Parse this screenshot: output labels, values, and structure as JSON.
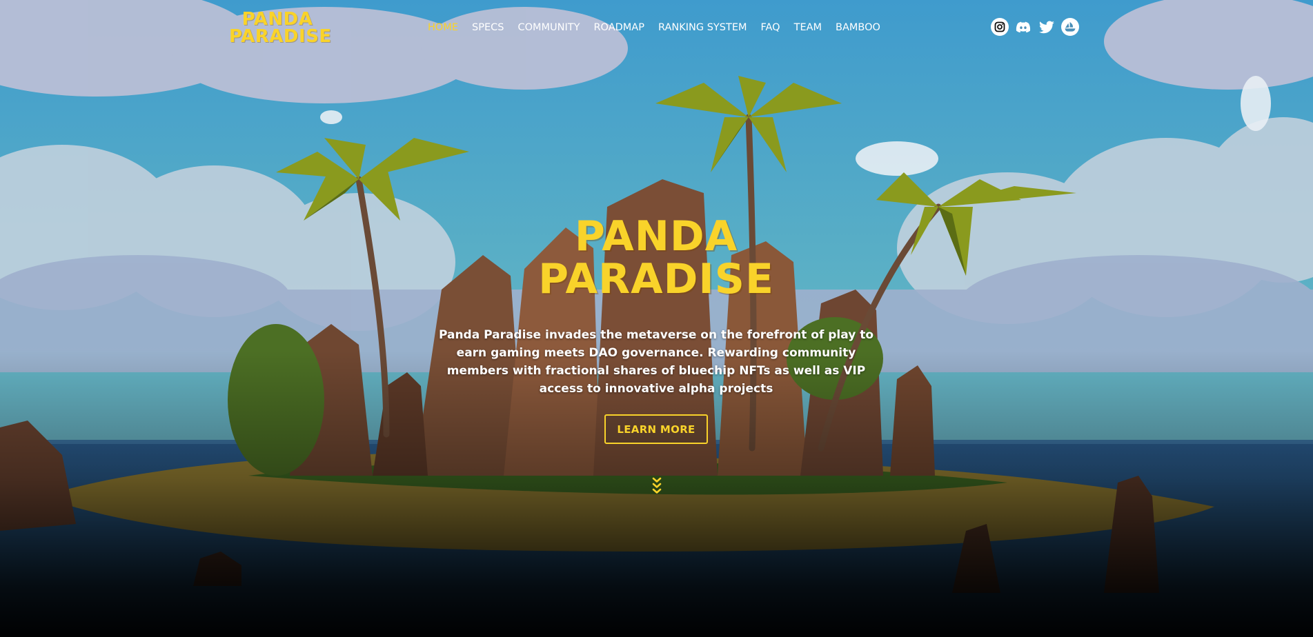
{
  "header": {
    "logo_line1": "PANDA",
    "logo_line2": "PARADISE"
  },
  "nav": {
    "items": [
      {
        "label": "HOME",
        "active": true
      },
      {
        "label": "SPECS",
        "active": false
      },
      {
        "label": "COMMUNITY",
        "active": false
      },
      {
        "label": "ROADMAP",
        "active": false
      },
      {
        "label": "RANKING SYSTEM",
        "active": false
      },
      {
        "label": "FAQ",
        "active": false
      },
      {
        "label": "TEAM",
        "active": false
      },
      {
        "label": "BAMBOO",
        "active": false
      }
    ]
  },
  "social": {
    "icons": [
      "instagram-icon",
      "discord-icon",
      "twitter-icon",
      "opensea-icon"
    ]
  },
  "hero": {
    "title_line1": "PANDA",
    "title_line2": "PARADISE",
    "description": "Panda Paradise invades the metaverse on the forefront of play to earn gaming meets DAO governance. Rewarding community members with fractional shares of bluechip NFTs as well as VIP access to innovative alpha projects",
    "cta_label": "LEARN MORE",
    "scroll_icon": "chevrons-down-icon"
  },
  "colors": {
    "accent": "#f9d32a",
    "text": "#ffffff",
    "sky": "#49a6c8",
    "sea": "#2a5e8c"
  }
}
